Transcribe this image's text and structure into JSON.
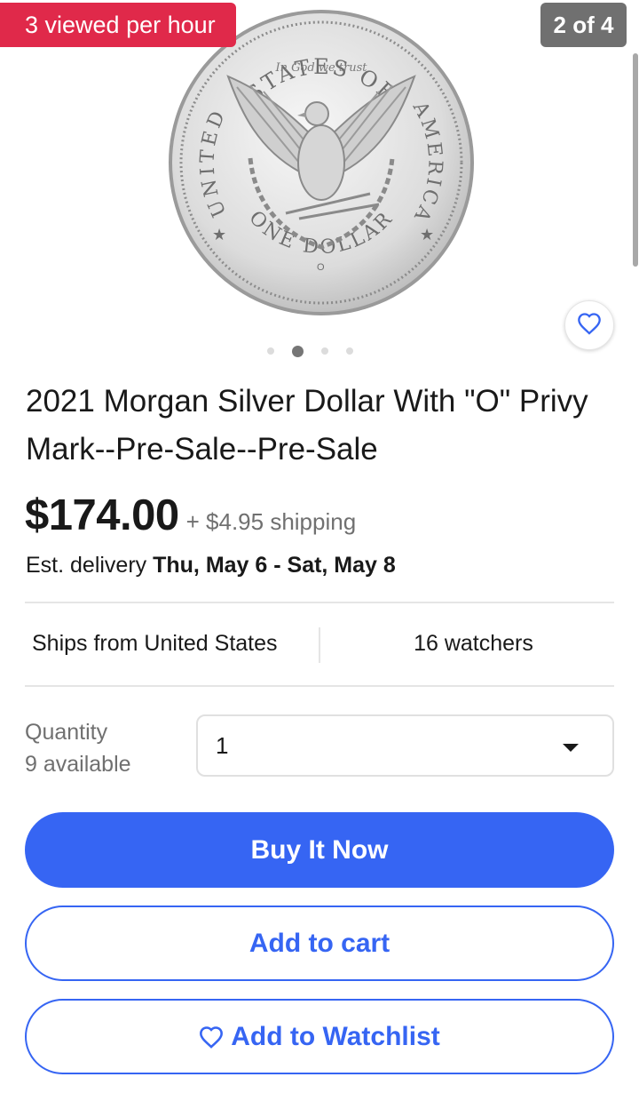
{
  "gallery": {
    "viewed_badge": "3 viewed per hour",
    "counter": "2 of 4",
    "image_count": 4,
    "active_index": 1,
    "coin": {
      "top_legend": "STATES OF",
      "left_legend": "UNITED",
      "right_legend": "AMERICA",
      "bottom_legend": "ONE DOLLAR",
      "motto": "In God we trust",
      "mint_mark": "O"
    }
  },
  "listing": {
    "title": "2021 Morgan Silver Dollar With \"O\" Privy Mark--Pre-Sale--Pre-Sale",
    "price": "$174.00",
    "shipping": "+ $4.95 shipping",
    "delivery_prefix": "Est. delivery ",
    "delivery_dates": "Thu, May 6 - Sat, May 8",
    "ships_from": "Ships from United States",
    "watchers": "16 watchers"
  },
  "quantity": {
    "label": "Quantity",
    "available": "9 available",
    "selected": "1"
  },
  "actions": {
    "buy_now": "Buy It Now",
    "add_to_cart": "Add to cart",
    "add_to_watchlist": "Add to Watchlist"
  },
  "colors": {
    "accent_blue": "#3665f3",
    "badge_red": "#e0294a",
    "counter_gray": "#707070"
  }
}
